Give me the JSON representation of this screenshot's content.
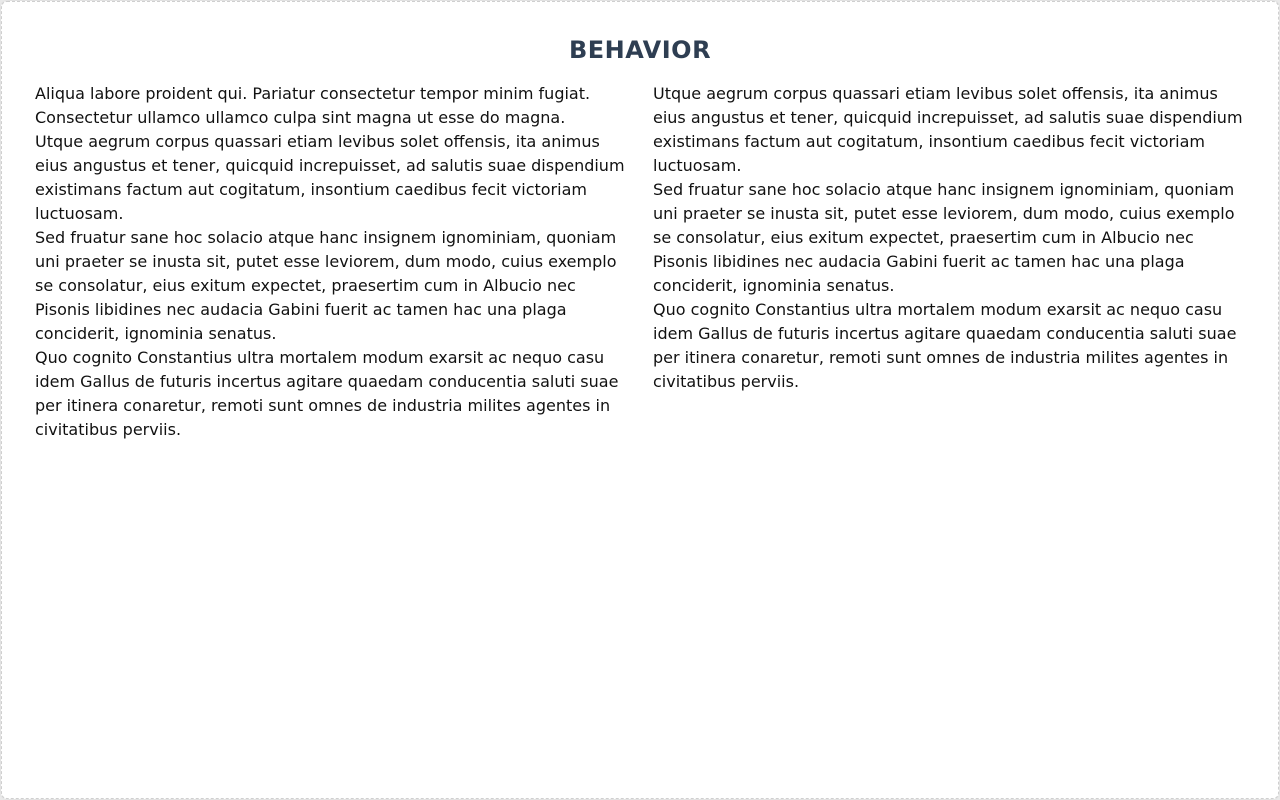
{
  "document": {
    "title": "BEHAVIOR",
    "columns": [
      {
        "paragraphs": [
          "Aliqua labore proident qui. Pariatur consectetur tempor minim fugiat. Consectetur ullamco ullamco culpa sint magna ut esse do magna.",
          "Utque aegrum corpus quassari etiam levibus solet offensis, ita animus eius angustus et tener, quicquid increpuisset, ad salutis suae dispendium existimans factum aut cogitatum, insontium caedibus fecit victoriam luctuosam.",
          "Sed fruatur sane hoc solacio atque hanc insignem ignominiam, quoniam uni praeter se inusta sit, putet esse leviorem, dum modo, cuius exemplo se consolatur, eius exitum expectet, praesertim cum in Albucio nec Pisonis libidines nec audacia Gabini fuerit ac tamen hac una plaga conciderit, ignominia senatus.",
          "Quo cognito Constantius ultra mortalem modum exarsit ac nequo casu idem Gallus de futuris incertus agitare quaedam conducentia saluti suae per itinera conaretur, remoti sunt omnes de industria milites agentes in civitatibus perviis."
        ]
      },
      {
        "paragraphs": [
          "Utque aegrum corpus quassari etiam levibus solet offensis, ita animus eius angustus et tener, quicquid increpuisset, ad salutis suae dispendium existimans factum aut cogitatum, insontium caedibus fecit victoriam luctuosam.",
          "Sed fruatur sane hoc solacio atque hanc insignem ignominiam, quoniam uni praeter se inusta sit, putet esse leviorem, dum modo, cuius exemplo se consolatur, eius exitum expectet, praesertim cum in Albucio nec Pisonis libidines nec audacia Gabini fuerit ac tamen hac una plaga conciderit, ignominia senatus.",
          "Quo cognito Constantius ultra mortalem modum exarsit ac nequo casu idem Gallus de futuris incertus agitare quaedam conducentia saluti suae per itinera conaretur, remoti sunt omnes de industria milites agentes in civitatibus perviis."
        ]
      }
    ]
  }
}
